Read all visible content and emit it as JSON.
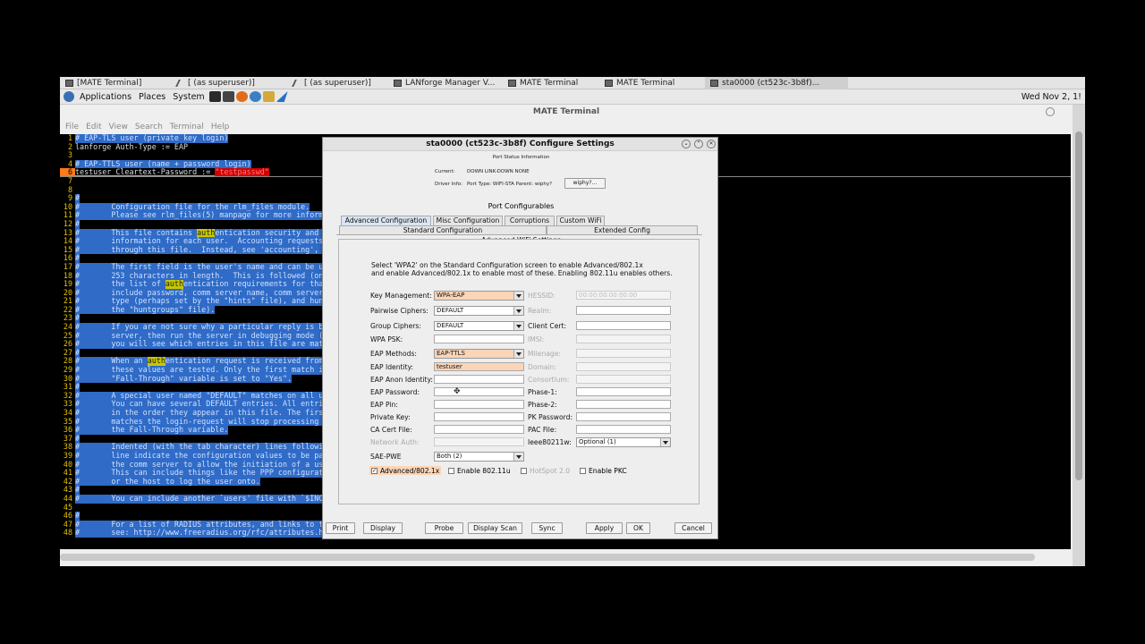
{
  "taskbar": {
    "items": [
      {
        "label": "[MATE Terminal]",
        "icon": "terminal-icon",
        "pen": false,
        "active": false
      },
      {
        "label": "[ (as superuser)]",
        "icon": "edit-icon",
        "pen": true,
        "active": false
      },
      {
        "label": "[ (as superuser)]",
        "icon": "edit-icon",
        "pen": true,
        "active": false
      },
      {
        "label": "LANforge Manager   V...",
        "icon": "lanforge-icon",
        "pen": false,
        "active": false
      },
      {
        "label": "MATE Terminal",
        "icon": "terminal-icon",
        "pen": false,
        "active": false
      },
      {
        "label": "MATE Terminal",
        "icon": "terminal-icon",
        "pen": false,
        "active": false
      },
      {
        "label": "sta0000  (ct523c-3b8f)...",
        "icon": "java-icon",
        "pen": false,
        "active": true
      }
    ]
  },
  "panel": {
    "applications": "Applications",
    "places": "Places",
    "system": "System",
    "clock": "Wed Nov  2, 1!"
  },
  "terminal": {
    "title": "MATE Terminal",
    "menu": [
      "File",
      "Edit",
      "View",
      "Search",
      "Terminal",
      "Help"
    ],
    "lines": [
      {
        "n": "1",
        "segs": [
          {
            "t": "# EAP-TLS user (private key login)",
            "c": "sel"
          }
        ]
      },
      {
        "n": "2",
        "segs": [
          {
            "t": "lanforge Auth-Type := EAP",
            "c": ""
          }
        ]
      },
      {
        "n": "3",
        "segs": [
          {
            "t": "",
            "c": ""
          }
        ]
      },
      {
        "n": "4",
        "segs": [
          {
            "t": "# EAP-TTLS user (name + password login)",
            "c": "sel"
          }
        ]
      },
      {
        "n": "6",
        "segs": [
          {
            "t": "testuser Cleartext-Password := ",
            "c": "curline"
          },
          {
            "t": "\"testpasswd\"",
            "c": "red"
          }
        ],
        "cur": true
      },
      {
        "n": "7",
        "segs": [
          {
            "t": "",
            "c": ""
          }
        ]
      },
      {
        "n": "8",
        "segs": [
          {
            "t": "",
            "c": ""
          }
        ]
      },
      {
        "n": "9",
        "segs": [
          {
            "t": "#",
            "c": "sel"
          }
        ]
      },
      {
        "n": "10",
        "segs": [
          {
            "t": "#       Configuration file for the rlm_files module.",
            "c": "sel"
          }
        ]
      },
      {
        "n": "11",
        "segs": [
          {
            "t": "#       Please see rlm_files(5) manpage for more informa",
            "c": "sel"
          }
        ]
      },
      {
        "n": "12",
        "segs": [
          {
            "t": "#",
            "c": "sel"
          }
        ]
      },
      {
        "n": "13",
        "segs": [
          {
            "t": "#       This file contains ",
            "c": "sel"
          },
          {
            "t": "auth",
            "c": "hl"
          },
          {
            "t": "entication security and co",
            "c": "sel"
          }
        ]
      },
      {
        "n": "14",
        "segs": [
          {
            "t": "#       information for each user.  Accounting requests",
            "c": "sel"
          }
        ]
      },
      {
        "n": "15",
        "segs": [
          {
            "t": "#       through this file.  Instead, see 'accounting', i",
            "c": "sel"
          }
        ]
      },
      {
        "n": "16",
        "segs": [
          {
            "t": "#",
            "c": "sel"
          }
        ]
      },
      {
        "n": "17",
        "segs": [
          {
            "t": "#       The first field is the user's name and can be up",
            "c": "sel"
          }
        ]
      },
      {
        "n": "18",
        "segs": [
          {
            "t": "#       253 characters in length.  This is followed (on",
            "c": "sel"
          }
        ]
      },
      {
        "n": "19",
        "segs": [
          {
            "t": "#       the list of ",
            "c": "sel"
          },
          {
            "t": "auth",
            "c": "hl"
          },
          {
            "t": "entication requirements for that",
            "c": "sel"
          }
        ]
      },
      {
        "n": "20",
        "segs": [
          {
            "t": "#       include password, comm server name, comm server p",
            "c": "sel"
          }
        ]
      },
      {
        "n": "21",
        "segs": [
          {
            "t": "#       type (perhaps set by the \"hints\" file), and hunt",
            "c": "sel"
          }
        ]
      },
      {
        "n": "22",
        "segs": [
          {
            "t": "#       the \"huntgroups\" file).",
            "c": "sel"
          }
        ]
      },
      {
        "n": "23",
        "segs": [
          {
            "t": "#",
            "c": "sel"
          }
        ]
      },
      {
        "n": "24",
        "segs": [
          {
            "t": "#       If you are not sure why a particular reply is be",
            "c": "sel"
          }
        ]
      },
      {
        "n": "25",
        "segs": [
          {
            "t": "#       server, then run the server in debugging mode (r",
            "c": "sel"
          }
        ]
      },
      {
        "n": "26",
        "segs": [
          {
            "t": "#       you will see which entries in this file are matc",
            "c": "sel"
          }
        ]
      },
      {
        "n": "27",
        "segs": [
          {
            "t": "#",
            "c": "sel"
          }
        ]
      },
      {
        "n": "28",
        "segs": [
          {
            "t": "#       When an ",
            "c": "sel"
          },
          {
            "t": "auth",
            "c": "hl"
          },
          {
            "t": "entication request is received from t",
            "c": "sel"
          }
        ]
      },
      {
        "n": "29",
        "segs": [
          {
            "t": "#       these values are tested. Only the first match is",
            "c": "sel"
          }
        ]
      },
      {
        "n": "30",
        "segs": [
          {
            "t": "#       \"Fall-Through\" variable is set to \"Yes\".",
            "c": "sel"
          }
        ]
      },
      {
        "n": "31",
        "segs": [
          {
            "t": "#",
            "c": "sel"
          }
        ]
      },
      {
        "n": "32",
        "segs": [
          {
            "t": "#       A special user named \"DEFAULT\" matches on all use",
            "c": "sel"
          }
        ]
      },
      {
        "n": "33",
        "segs": [
          {
            "t": "#       You can have several DEFAULT entries. All entrie",
            "c": "sel"
          }
        ]
      },
      {
        "n": "34",
        "segs": [
          {
            "t": "#       in the order they appear in this file. The first",
            "c": "sel"
          }
        ]
      },
      {
        "n": "35",
        "segs": [
          {
            "t": "#       matches the login-request will stop processing u",
            "c": "sel"
          }
        ]
      },
      {
        "n": "36",
        "segs": [
          {
            "t": "#       the Fall-Through variable.",
            "c": "sel"
          }
        ]
      },
      {
        "n": "37",
        "segs": [
          {
            "t": "#",
            "c": "sel"
          }
        ]
      },
      {
        "n": "38",
        "segs": [
          {
            "t": "#       Indented (with the tab character) lines followin",
            "c": "sel"
          }
        ]
      },
      {
        "n": "39",
        "segs": [
          {
            "t": "#       line indicate the configuration values to be pas",
            "c": "sel"
          }
        ]
      },
      {
        "n": "40",
        "segs": [
          {
            "t": "#       the comm server to allow the initiation of a user",
            "c": "sel"
          }
        ]
      },
      {
        "n": "41",
        "segs": [
          {
            "t": "#       This can include things like the PPP configurati",
            "c": "sel"
          }
        ]
      },
      {
        "n": "42",
        "segs": [
          {
            "t": "#       or the host to log the user onto.",
            "c": "sel"
          }
        ]
      },
      {
        "n": "43",
        "segs": [
          {
            "t": "#",
            "c": "sel"
          }
        ]
      },
      {
        "n": "44",
        "segs": [
          {
            "t": "#       You can include another `users' file with `$INCLU",
            "c": "sel"
          }
        ]
      },
      {
        "n": "45",
        "segs": [
          {
            "t": "",
            "c": ""
          }
        ]
      },
      {
        "n": "46",
        "segs": [
          {
            "t": "#",
            "c": "sel"
          }
        ]
      },
      {
        "n": "47",
        "segs": [
          {
            "t": "#       For a list of RADIUS attributes, and links to th",
            "c": "sel"
          }
        ]
      },
      {
        "n": "48",
        "segs": [
          {
            "t": "#       see: http://www.freeradius.org/rfc/attributes.htm",
            "c": "sel"
          }
        ]
      }
    ]
  },
  "dialog": {
    "title": "sta0000  (ct523c-3b8f) Configure Settings",
    "port_status_heading": "Port Status Information",
    "current_label": "Current:",
    "current_value": "DOWN  LINK-DOWN  NONE",
    "driver_label": "Driver Info:",
    "driver_value": "Port Type: WIFI-STA   Parent: wiphy?",
    "wiphy_button": "wiphy?...",
    "port_configurables": "Port Configurables",
    "tabs_row1": [
      "Advanced Configuration",
      "Misc Configuration",
      "Corruptions",
      "Custom WiFi"
    ],
    "tabs_row2": [
      "Standard Configuration",
      "Extended Config"
    ],
    "section_title": "Advanced WiFi Settings",
    "instructions1": "Select 'WPA2' on the Standard Configuration screen to enable Advanced/802.1x",
    "instructions2": "and enable Advanced/802.1x to enable most of these. Enabling 802.11u enables others.",
    "fields": {
      "key_mgmt_label": "Key Management:",
      "key_mgmt_value": "WPA-EAP",
      "hessid_label": "HESSID:",
      "hessid_value": "00:00:00:00:00:00",
      "pairwise_label": "Pairwise Ciphers:",
      "pairwise_value": "DEFAULT",
      "realm_label": "Realm:",
      "group_label": "Group Ciphers:",
      "group_value": "DEFAULT",
      "client_cert_label": "Client Cert:",
      "wpa_psk_label": "WPA PSK:",
      "imsi_label": "IMSI:",
      "eap_methods_label": "EAP Methods:",
      "eap_methods_value": "EAP-TTLS",
      "milenage_label": "Milenage:",
      "eap_identity_label": "EAP Identity:",
      "eap_identity_value": "testuser",
      "domain_label": "Domain:",
      "eap_anon_label": "EAP Anon Identity:",
      "consortium_label": "Consortium:",
      "eap_password_label": "EAP Password:",
      "phase1_label": "Phase-1:",
      "eap_pin_label": "EAP Pin:",
      "phase2_label": "Phase-2:",
      "private_key_label": "Private Key:",
      "pk_password_label": "PK Password:",
      "ca_cert_label": "CA Cert File:",
      "pac_file_label": "PAC File:",
      "network_auth_label": "Network Auth:",
      "ieee80211w_label": "Ieee80211w:",
      "ieee80211w_value": "Optional  (1)",
      "sae_pwe_label": "SAE-PWE",
      "sae_pwe_value": "Both     (2)"
    },
    "checks": {
      "advanced": "Advanced/802.1x",
      "enable_80211u": "Enable 802.11u",
      "hotspot": "HotSpot 2.0",
      "enable_pkc": "Enable PKC"
    },
    "buttons": [
      "Print",
      "Display",
      "Probe",
      "Display Scan",
      "Sync",
      "Apply",
      "OK",
      "Cancel"
    ]
  }
}
